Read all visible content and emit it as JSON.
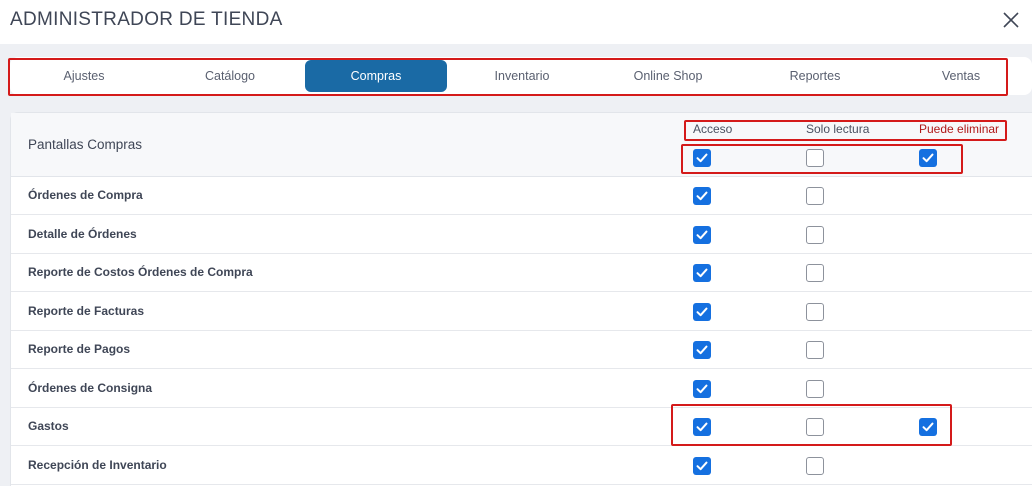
{
  "header": {
    "title": "ADMINISTRADOR DE TIENDA",
    "close_icon": "close-icon"
  },
  "tabs": [
    {
      "id": "ajustes",
      "label": "Ajustes",
      "active": false
    },
    {
      "id": "catalogo",
      "label": "Catálogo",
      "active": false
    },
    {
      "id": "compras",
      "label": "Compras",
      "active": true
    },
    {
      "id": "inventario",
      "label": "Inventario",
      "active": false
    },
    {
      "id": "online-shop",
      "label": "Online Shop",
      "active": false
    },
    {
      "id": "reportes",
      "label": "Reportes",
      "active": false
    },
    {
      "id": "ventas",
      "label": "Ventas",
      "active": false
    }
  ],
  "table": {
    "title": "Pantallas Compras",
    "columns": [
      "Acceso",
      "Solo lectura",
      "Puede eliminar"
    ],
    "header_checks": {
      "acceso": true,
      "solo_lectura": false,
      "puede_eliminar": true
    },
    "rows": [
      {
        "label": "Órdenes de Compra",
        "acceso": true,
        "solo_lectura": false,
        "puede_eliminar": null
      },
      {
        "label": "Detalle de Órdenes",
        "acceso": true,
        "solo_lectura": false,
        "puede_eliminar": null
      },
      {
        "label": "Reporte de Costos Órdenes de Compra",
        "acceso": true,
        "solo_lectura": false,
        "puede_eliminar": null
      },
      {
        "label": "Reporte de Facturas",
        "acceso": true,
        "solo_lectura": false,
        "puede_eliminar": null
      },
      {
        "label": "Reporte de Pagos",
        "acceso": true,
        "solo_lectura": false,
        "puede_eliminar": null
      },
      {
        "label": "Órdenes de Consigna",
        "acceso": true,
        "solo_lectura": false,
        "puede_eliminar": null
      },
      {
        "label": "Gastos",
        "acceso": true,
        "solo_lectura": false,
        "puede_eliminar": true
      },
      {
        "label": "Recepción de Inventario",
        "acceso": true,
        "solo_lectura": false,
        "puede_eliminar": null
      }
    ]
  },
  "colors": {
    "accent": "#1a6aa5",
    "checkbox": "#1570e0",
    "highlight": "#d41a1a",
    "danger_label": "#b01818"
  }
}
